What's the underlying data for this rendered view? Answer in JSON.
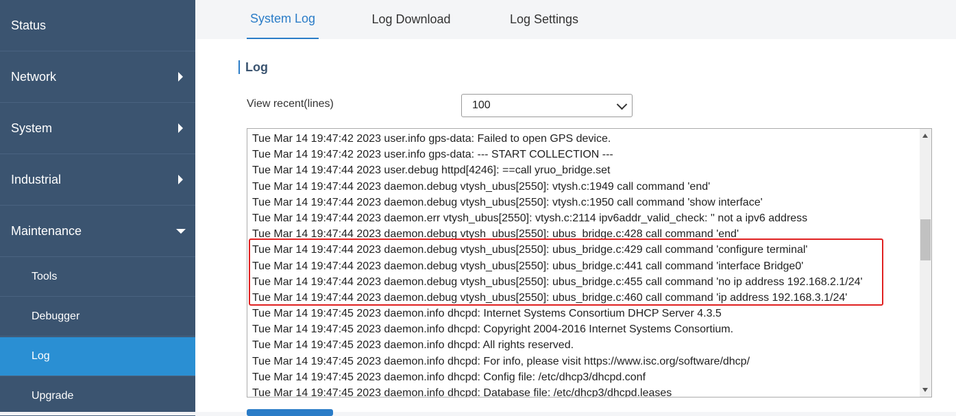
{
  "sidebar": {
    "items": [
      {
        "label": "Status"
      },
      {
        "label": "Network"
      },
      {
        "label": "System"
      },
      {
        "label": "Industrial"
      },
      {
        "label": "Maintenance"
      }
    ],
    "subitems": [
      {
        "label": "Tools"
      },
      {
        "label": "Debugger"
      },
      {
        "label": "Log"
      },
      {
        "label": "Upgrade"
      }
    ]
  },
  "tabs": [
    {
      "label": "System Log"
    },
    {
      "label": "Log Download"
    },
    {
      "label": "Log Settings"
    }
  ],
  "section": {
    "title": "Log"
  },
  "view_recent": {
    "label": "View recent(lines)",
    "value": "100"
  },
  "log_lines": [
    "Tue Mar 14 19:47:42 2023 user.info gps-data: Failed to open GPS device.",
    "Tue Mar 14 19:47:42 2023 user.info gps-data: --- START COLLECTION ---",
    "Tue Mar 14 19:47:44 2023 user.debug httpd[4246]: ==call yruo_bridge.set",
    "Tue Mar 14 19:47:44 2023 daemon.debug vtysh_ubus[2550]: vtysh.c:1949 call command 'end'",
    "Tue Mar 14 19:47:44 2023 daemon.debug vtysh_ubus[2550]: vtysh.c:1950 call command 'show interface'",
    "Tue Mar 14 19:47:44 2023 daemon.err vtysh_ubus[2550]: vtysh.c:2114 ipv6addr_valid_check: '' not a ipv6 address",
    "Tue Mar 14 19:47:44 2023 daemon.debug vtysh_ubus[2550]: ubus_bridge.c:428 call command 'end'",
    "Tue Mar 14 19:47:44 2023 daemon.debug vtysh_ubus[2550]: ubus_bridge.c:429 call command 'configure terminal'",
    "Tue Mar 14 19:47:44 2023 daemon.debug vtysh_ubus[2550]: ubus_bridge.c:441 call command 'interface Bridge0'",
    "Tue Mar 14 19:47:44 2023 daemon.debug vtysh_ubus[2550]: ubus_bridge.c:455 call command 'no ip address 192.168.2.1/24'",
    "Tue Mar 14 19:47:44 2023 daemon.debug vtysh_ubus[2550]: ubus_bridge.c:460 call command 'ip address 192.168.3.1/24'",
    "Tue Mar 14 19:47:45 2023 daemon.info dhcpd: Internet Systems Consortium DHCP Server 4.3.5",
    "Tue Mar 14 19:47:45 2023 daemon.info dhcpd: Copyright 2004-2016 Internet Systems Consortium.",
    "Tue Mar 14 19:47:45 2023 daemon.info dhcpd: All rights reserved.",
    "Tue Mar 14 19:47:45 2023 daemon.info dhcpd: For info, please visit https://www.isc.org/software/dhcp/",
    "Tue Mar 14 19:47:45 2023 daemon.info dhcpd: Config file: /etc/dhcp3/dhcpd.conf",
    "Tue Mar 14 19:47:45 2023 daemon.info dhcpd: Database file: /etc/dhcp3/dhcpd.leases"
  ],
  "colors": {
    "sidebar_bg": "#3b5470",
    "accent": "#2a7cc7",
    "highlight": "#e02020"
  }
}
